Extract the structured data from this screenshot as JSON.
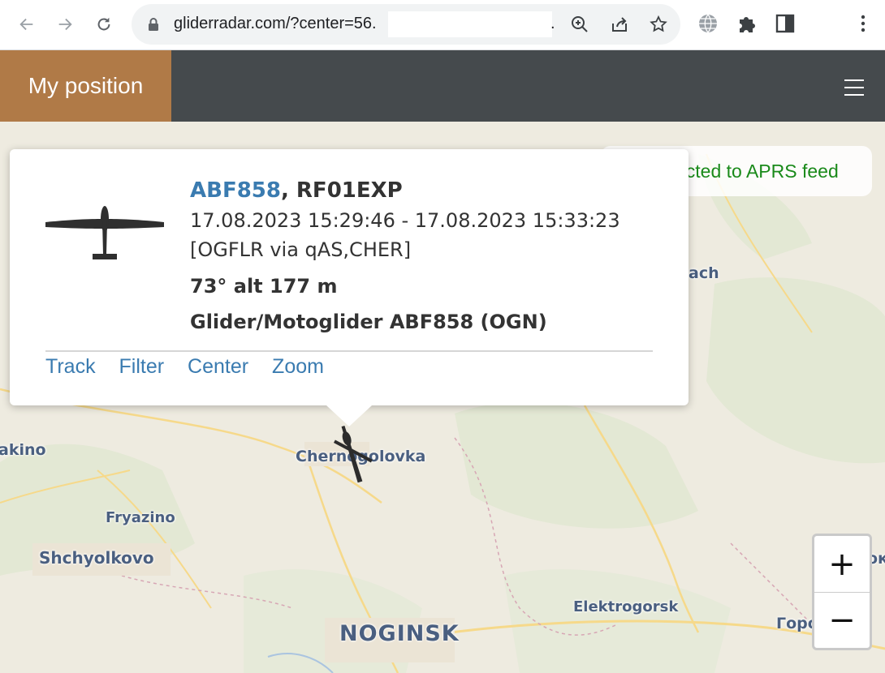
{
  "browser": {
    "url": "gliderradar.com/?center=56.",
    "url_trailing": "."
  },
  "app": {
    "my_position_label": "My position",
    "status_text": "Connected to APRS feed",
    "status_color": "#1a8a1a"
  },
  "popup": {
    "id": "ABF858",
    "callsign": ", RF01EXP",
    "time_range": "17.08.2023 15:29:46 - 17.08.2023 15:33:23",
    "via": "[OGFLR via qAS,CHER]",
    "heading_alt": "73° alt 177 m",
    "type": "Glider/Motoglider ABF858 (OGN)",
    "links": [
      "Track",
      "Filter",
      "Center",
      "Zoom"
    ]
  },
  "map": {
    "places": {
      "chernogolovka": "Chernogolovka",
      "fryazino": "Fryazino",
      "shchyolkovo": "Shchyolkovo",
      "elektrogorsk": "Elektrogorsk",
      "noginsk": "NOGINSK",
      "akino": "akino",
      "ach": "ach",
      "goro": "Горо",
      "ok": "ок"
    },
    "zoom_in": "+",
    "zoom_out": "−"
  }
}
